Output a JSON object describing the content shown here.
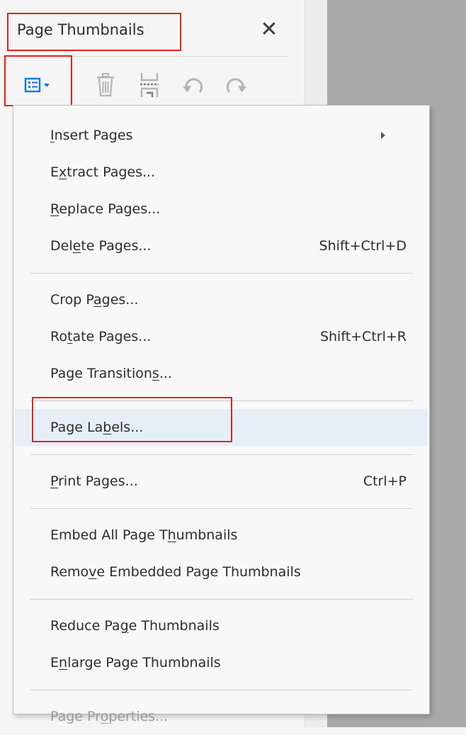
{
  "panel": {
    "title": "Page Thumbnails",
    "close_label": "✕",
    "toolbar": [
      {
        "name": "options-icon",
        "interactable": true
      },
      {
        "name": "delete-icon",
        "interactable": false
      },
      {
        "name": "insert-pages-icon",
        "interactable": false
      },
      {
        "name": "rotate-counterclockwise-icon",
        "interactable": false
      },
      {
        "name": "rotate-clockwise-icon",
        "interactable": false
      }
    ]
  },
  "menu": {
    "items": [
      {
        "id": "insert-pages",
        "pre": "",
        "acc": "I",
        "post": "nsert Pages",
        "shortcut": "",
        "submenu": true
      },
      {
        "id": "extract-pages",
        "pre": "E",
        "acc": "x",
        "post": "tract Pages...",
        "shortcut": ""
      },
      {
        "id": "replace-pages",
        "pre": "",
        "acc": "R",
        "post": "eplace Pages...",
        "shortcut": ""
      },
      {
        "id": "delete-pages",
        "pre": "Del",
        "acc": "e",
        "post": "te Pages...",
        "shortcut": "Shift+Ctrl+D"
      },
      {
        "separator": true
      },
      {
        "id": "crop-pages",
        "pre": "Crop P",
        "acc": "a",
        "post": "ges...",
        "shortcut": ""
      },
      {
        "id": "rotate-pages",
        "pre": "Ro",
        "acc": "t",
        "post": "ate Pages...",
        "shortcut": "Shift+Ctrl+R"
      },
      {
        "id": "page-transitions",
        "pre": "Page Transition",
        "acc": "s",
        "post": "...",
        "shortcut": ""
      },
      {
        "separator": true
      },
      {
        "id": "page-labels",
        "pre": "Page La",
        "acc": "b",
        "post": "els...",
        "shortcut": "",
        "hover": true
      },
      {
        "separator": true
      },
      {
        "id": "print-pages",
        "pre": "",
        "acc": "P",
        "post": "rint Pages...",
        "shortcut": "Ctrl+P"
      },
      {
        "separator": true
      },
      {
        "id": "embed-all-page-thumbnails",
        "pre": "Embed All Page T",
        "acc": "h",
        "post": "umbnails",
        "shortcut": ""
      },
      {
        "id": "remove-embedded-page-thumbnails",
        "pre": "Remo",
        "acc": "v",
        "post": "e Embedded Page Thumbnails",
        "shortcut": ""
      },
      {
        "separator": true
      },
      {
        "id": "reduce-page-thumbnails",
        "pre": "Reduce Pa",
        "acc": "g",
        "post": "e Thumbnails",
        "shortcut": ""
      },
      {
        "id": "enlarge-page-thumbnails",
        "pre": "E",
        "acc": "n",
        "post": "large Page Thumbnails",
        "shortcut": ""
      },
      {
        "separator": true
      },
      {
        "id": "page-properties",
        "pre": "Page Pr",
        "acc": "o",
        "post": "perties...",
        "shortcut": "",
        "disabled": true
      }
    ]
  },
  "colors": {
    "highlight_box": "#e2231a",
    "accent_icon": "#1473e6",
    "hover_bg": "#e6eff8",
    "disabled_text": "#9a9a9a"
  }
}
